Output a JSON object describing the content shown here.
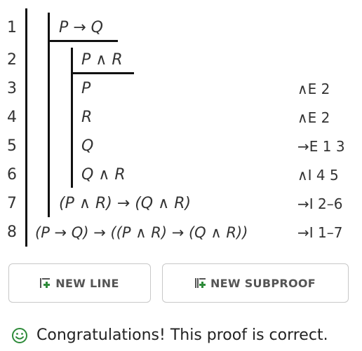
{
  "proof": {
    "lines": [
      {
        "num": "1",
        "formula": "P → Q",
        "justification": ""
      },
      {
        "num": "2",
        "formula": "P ∧ R",
        "justification": ""
      },
      {
        "num": "3",
        "formula": "P",
        "justification": "∧E 2"
      },
      {
        "num": "4",
        "formula": "R",
        "justification": "∧E 2"
      },
      {
        "num": "5",
        "formula": "Q",
        "justification": "→E 1 3"
      },
      {
        "num": "6",
        "formula": "Q ∧ R",
        "justification": "∧I 4 5"
      },
      {
        "num": "7",
        "formula": "(P ∧ R) → (Q ∧ R)",
        "justification": "→I 2–6"
      },
      {
        "num": "8",
        "formula": "(P → Q) → ((P ∧ R) → (Q ∧ R))",
        "justification": "→I 1–7"
      }
    ]
  },
  "buttons": {
    "new_line": "NEW LINE",
    "new_subproof": "NEW SUBPROOF"
  },
  "status": {
    "message": "Congratulations! This proof is correct."
  },
  "colors": {
    "accent_green": "#2e8b3a",
    "text": "#333333"
  },
  "icons": {
    "new_line": "add-line-icon",
    "new_subproof": "add-subproof-icon",
    "status": "smiley-icon"
  }
}
